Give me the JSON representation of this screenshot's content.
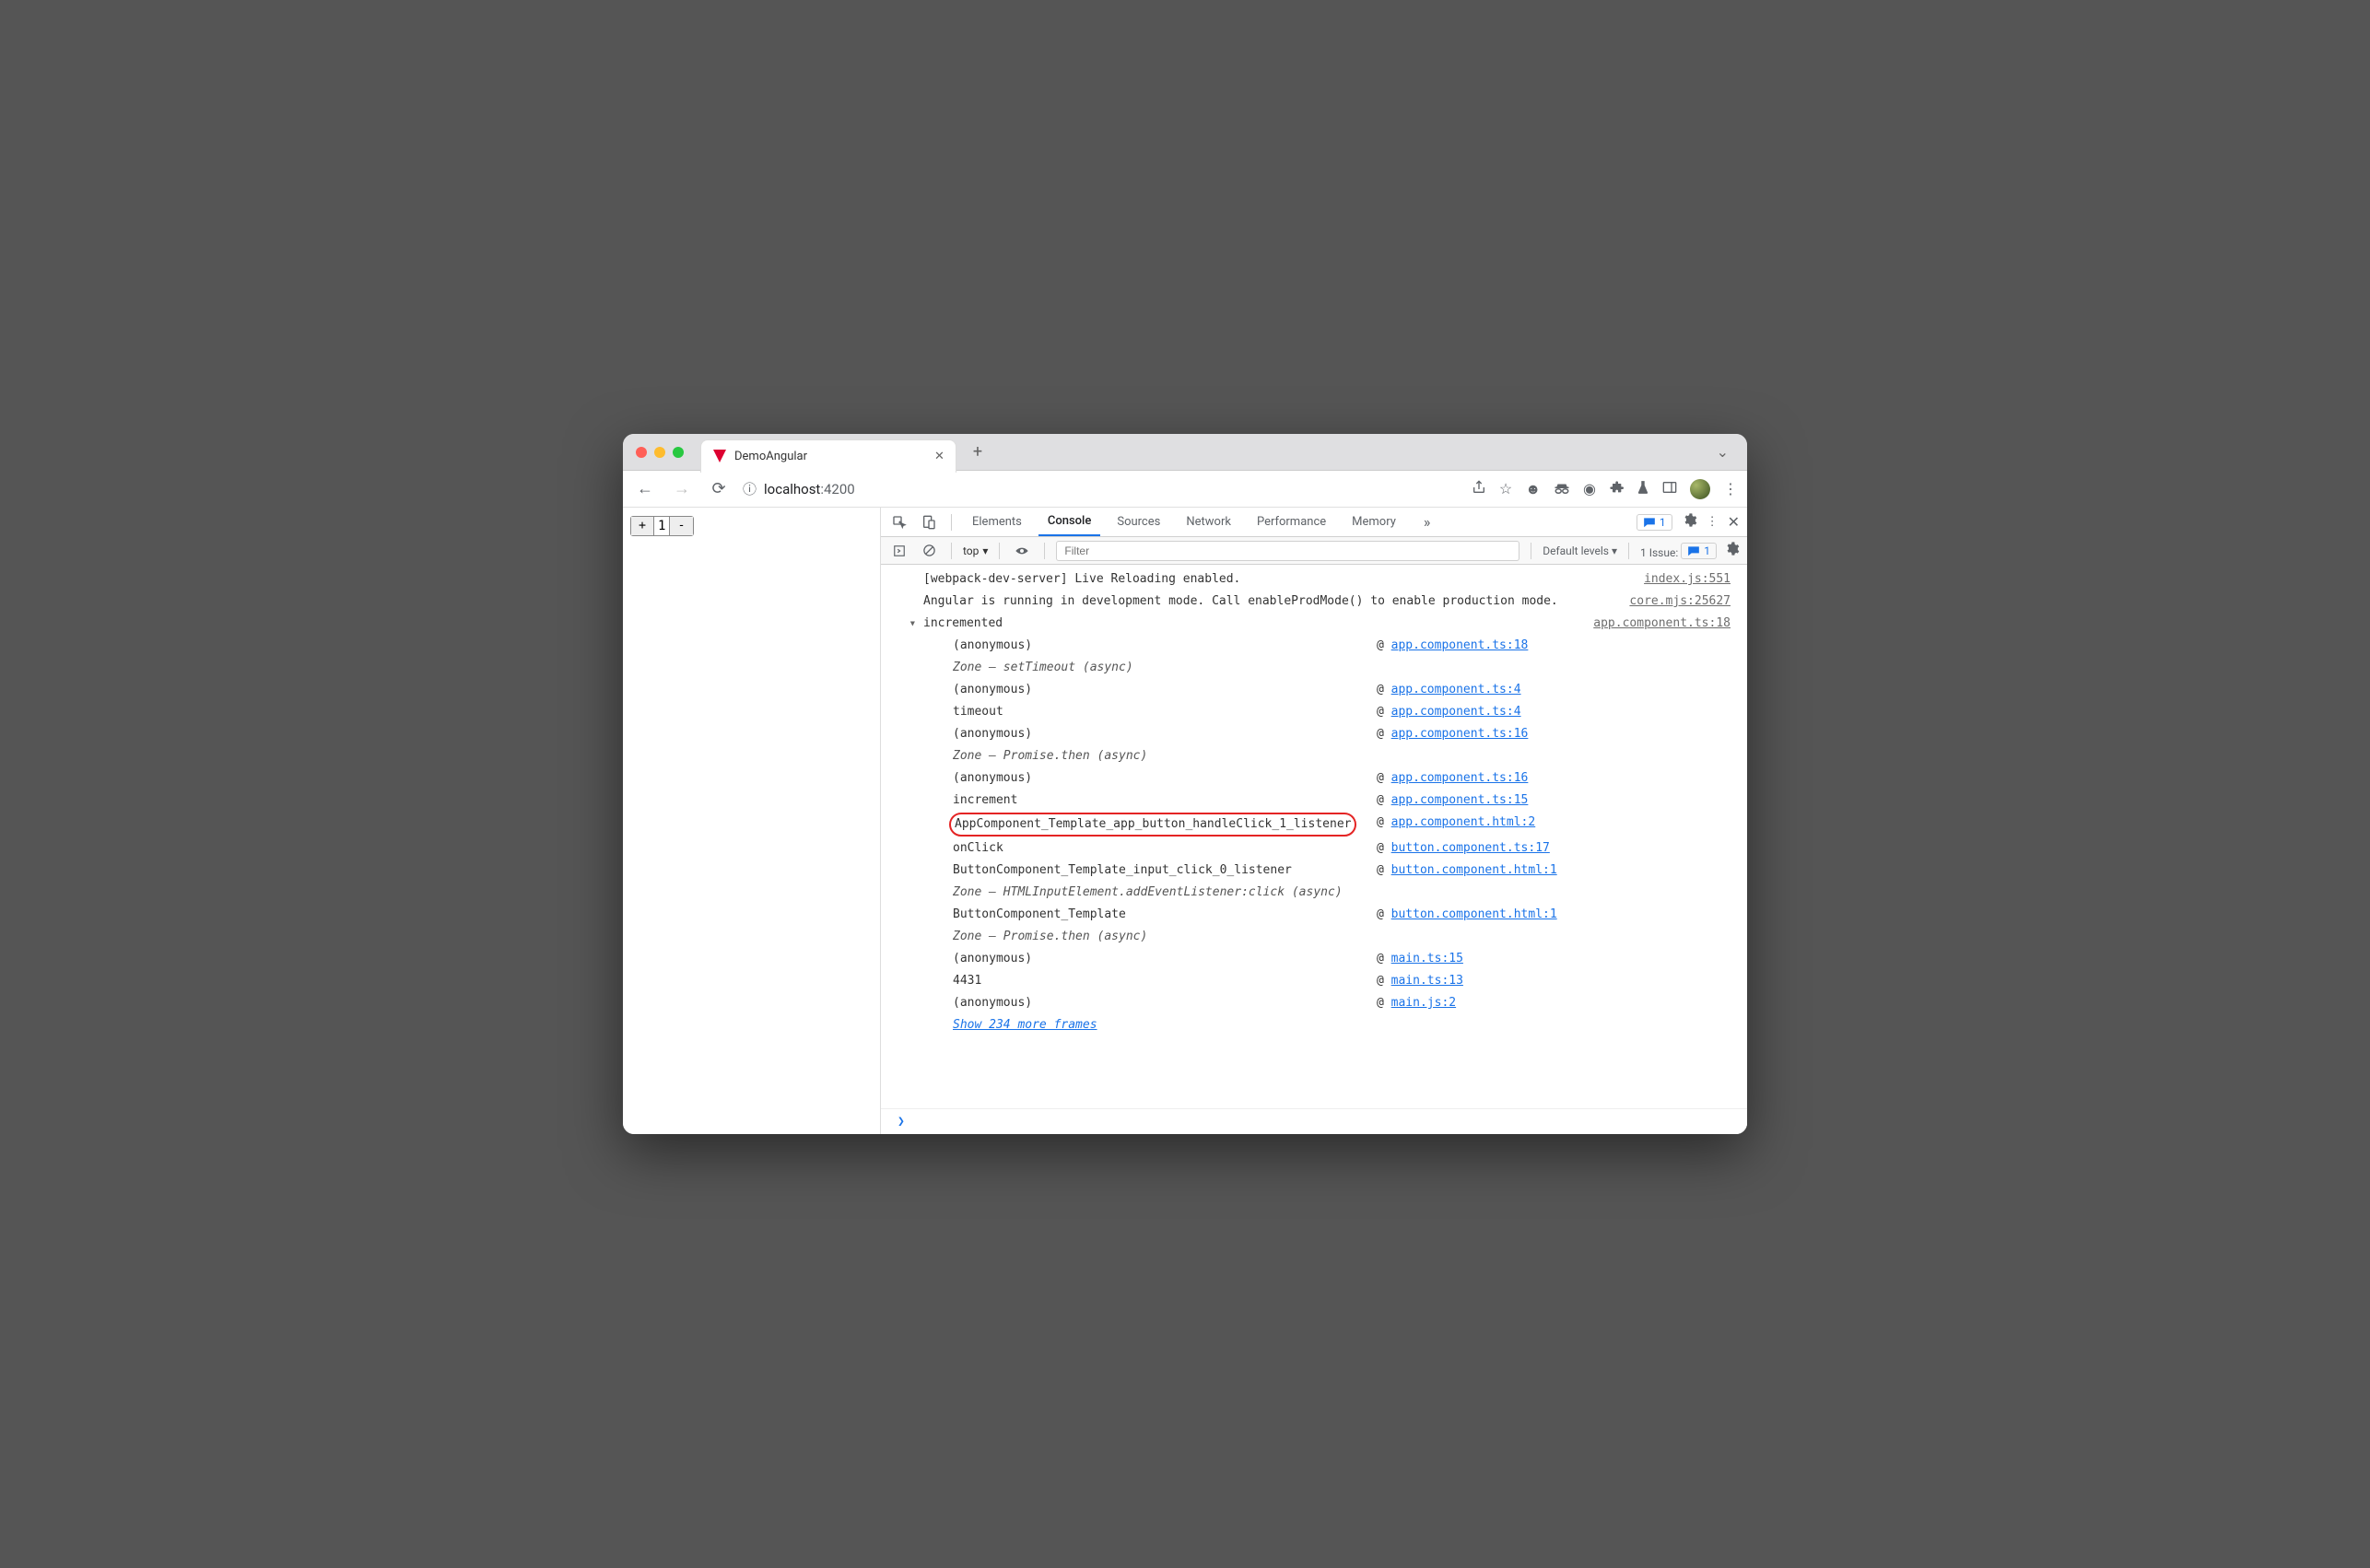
{
  "browserTab": {
    "title": "DemoAngular"
  },
  "address": {
    "scheme_icon_tooltip": "Info",
    "host": "localhost",
    "port": ":4200"
  },
  "page": {
    "counter_value": "1",
    "plus": "+",
    "minus": "-"
  },
  "devtools": {
    "tabs": {
      "elements": "Elements",
      "console": "Console",
      "sources": "Sources",
      "network": "Network",
      "performance": "Performance",
      "memory": "Memory"
    },
    "chip_count": "1",
    "sub": {
      "context": "top",
      "filter_placeholder": "Filter",
      "levels": "Default levels",
      "issues_label": "1 Issue:",
      "issues_count": "1"
    }
  },
  "console": {
    "log1": {
      "text": "[webpack-dev-server] Live Reloading enabled.",
      "src": "index.js:551"
    },
    "log2": {
      "text": "Angular is running in development mode. Call enableProdMode() to enable production mode.",
      "src": "core.mjs:25627"
    },
    "group_label": "incremented",
    "group_src": "app.component.ts:18",
    "frames": [
      {
        "name": "(anonymous)",
        "at": "@",
        "src": "app.component.ts:18",
        "link": true
      },
      {
        "name": "Zone — setTimeout (async)",
        "italic": true
      },
      {
        "name": "(anonymous)",
        "at": "@",
        "src": "app.component.ts:4",
        "link": true
      },
      {
        "name": "timeout",
        "at": "@",
        "src": "app.component.ts:4",
        "link": true
      },
      {
        "name": "(anonymous)",
        "at": "@",
        "src": "app.component.ts:16",
        "link": true
      },
      {
        "name": "Zone — Promise.then (async)",
        "italic": true
      },
      {
        "name": "(anonymous)",
        "at": "@",
        "src": "app.component.ts:16",
        "link": true
      },
      {
        "name": "increment",
        "at": "@",
        "src": "app.component.ts:15",
        "link": true
      },
      {
        "name": "AppComponent_Template_app_button_handleClick_1_listener",
        "at": "@",
        "src": "app.component.html:2",
        "link": true,
        "highlight": true
      },
      {
        "name": "onClick",
        "at": "@",
        "src": "button.component.ts:17",
        "link": true
      },
      {
        "name": "ButtonComponent_Template_input_click_0_listener",
        "at": "@",
        "src": "button.component.html:1",
        "link": true
      },
      {
        "name": "Zone — HTMLInputElement.addEventListener:click (async)",
        "italic": true
      },
      {
        "name": "ButtonComponent_Template",
        "at": "@",
        "src": "button.component.html:1",
        "link": true
      },
      {
        "name": "Zone — Promise.then (async)",
        "italic": true
      },
      {
        "name": "(anonymous)",
        "at": "@",
        "src": "main.ts:15",
        "link": true
      },
      {
        "name": "4431",
        "at": "@",
        "src": "main.ts:13",
        "link": true
      },
      {
        "name": "(anonymous)",
        "at": "@",
        "src": "main.js:2",
        "link": true
      }
    ],
    "show_more": "Show 234 more frames",
    "prompt": "❯"
  }
}
